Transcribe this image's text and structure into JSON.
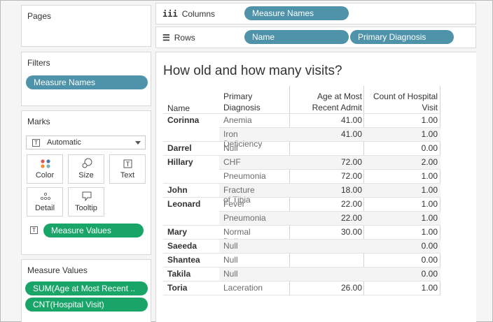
{
  "panels": {
    "pages_title": "Pages",
    "filters_title": "Filters",
    "marks_title": "Marks",
    "measure_values_title": "Measure Values"
  },
  "filters": {
    "pill": "Measure Names"
  },
  "shelves": {
    "columns_label": "Columns",
    "rows_label": "Rows",
    "columns_pills": [
      "Measure Names"
    ],
    "rows_pills": [
      "Name",
      "Primary Diagnosis"
    ]
  },
  "marks": {
    "type": "Automatic",
    "buttons": {
      "color": "Color",
      "size": "Size",
      "text": "Text",
      "detail": "Detail",
      "tooltip": "Tooltip"
    },
    "text_pill": "Measure Values"
  },
  "measure_values": {
    "items": [
      "SUM(Age at Most Recent ..",
      "CNT(Hospital Visit)"
    ]
  },
  "view": {
    "title": "How old and how many visits?",
    "headers": {
      "name": "Name",
      "diag_line1": "Primary",
      "diag_line2": "Diagnosis",
      "age_line1": "Age at Most",
      "age_line2": "Recent Admit",
      "count_line1": "Count of Hospital",
      "count_line2": "Visit"
    },
    "rows": [
      {
        "name": "Corinna",
        "diagnosis": "Anemia",
        "age": "41.00",
        "count": "1.00"
      },
      {
        "name": "",
        "diagnosis": "Iron Deficiency",
        "age": "41.00",
        "count": "1.00"
      },
      {
        "name": "Darrel",
        "diagnosis": "Null",
        "age": "",
        "count": "0.00"
      },
      {
        "name": "Hillary",
        "diagnosis": "CHF",
        "age": "72.00",
        "count": "2.00"
      },
      {
        "name": "",
        "diagnosis": "Pneumonia",
        "age": "72.00",
        "count": "1.00"
      },
      {
        "name": "John",
        "diagnosis": "Fracture of Tibia",
        "age": "18.00",
        "count": "1.00"
      },
      {
        "name": "Leonard",
        "diagnosis": "Fever",
        "age": "22.00",
        "count": "1.00"
      },
      {
        "name": "",
        "diagnosis": "Pneumonia",
        "age": "22.00",
        "count": "1.00"
      },
      {
        "name": "Mary",
        "diagnosis": "Normal Delivery",
        "age": "30.00",
        "count": "1.00"
      },
      {
        "name": "Saeeda",
        "diagnosis": "Null",
        "age": "",
        "count": "0.00"
      },
      {
        "name": "Shantea",
        "diagnosis": "Null",
        "age": "",
        "count": "0.00"
      },
      {
        "name": "Takila",
        "diagnosis": "Null",
        "age": "",
        "count": "0.00"
      },
      {
        "name": "Toria",
        "diagnosis": "Laceration",
        "age": "26.00",
        "count": "1.00"
      }
    ]
  },
  "colors": {
    "dimension_pill": "#4e93aa",
    "measure_pill": "#1aa568"
  }
}
